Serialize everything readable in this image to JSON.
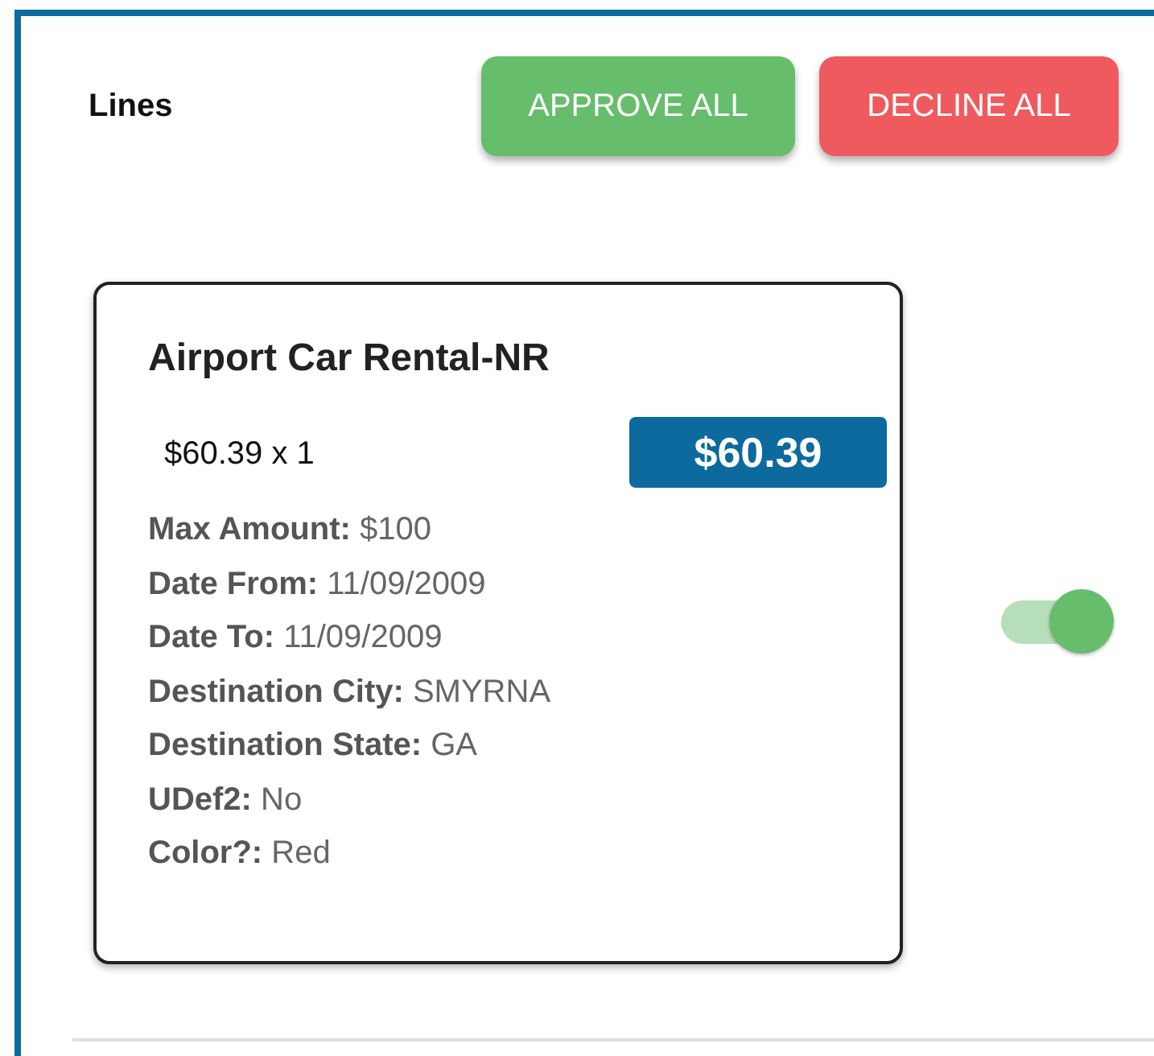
{
  "header": {
    "title": "Lines",
    "buttons": [
      {
        "label": "APPROVE ALL",
        "kind": "approve"
      },
      {
        "label": "DECLINE ALL",
        "kind": "decline"
      }
    ]
  },
  "lines": [
    {
      "title": "Airport Car Rental-NR",
      "quantity_text": "$60.39 x 1",
      "total": "$60.39",
      "approved": true,
      "details": [
        {
          "label": "Max Amount:",
          "value": "$100"
        },
        {
          "label": "Date From:",
          "value": "11/09/2009"
        },
        {
          "label": "Date To:",
          "value": "11/09/2009"
        },
        {
          "label": "Destination City:",
          "value": "SMYRNA"
        },
        {
          "label": "Destination State:",
          "value": "GA"
        },
        {
          "label": "UDef2:",
          "value": "No"
        },
        {
          "label": "Color?:",
          "value": "Red"
        }
      ]
    }
  ]
}
